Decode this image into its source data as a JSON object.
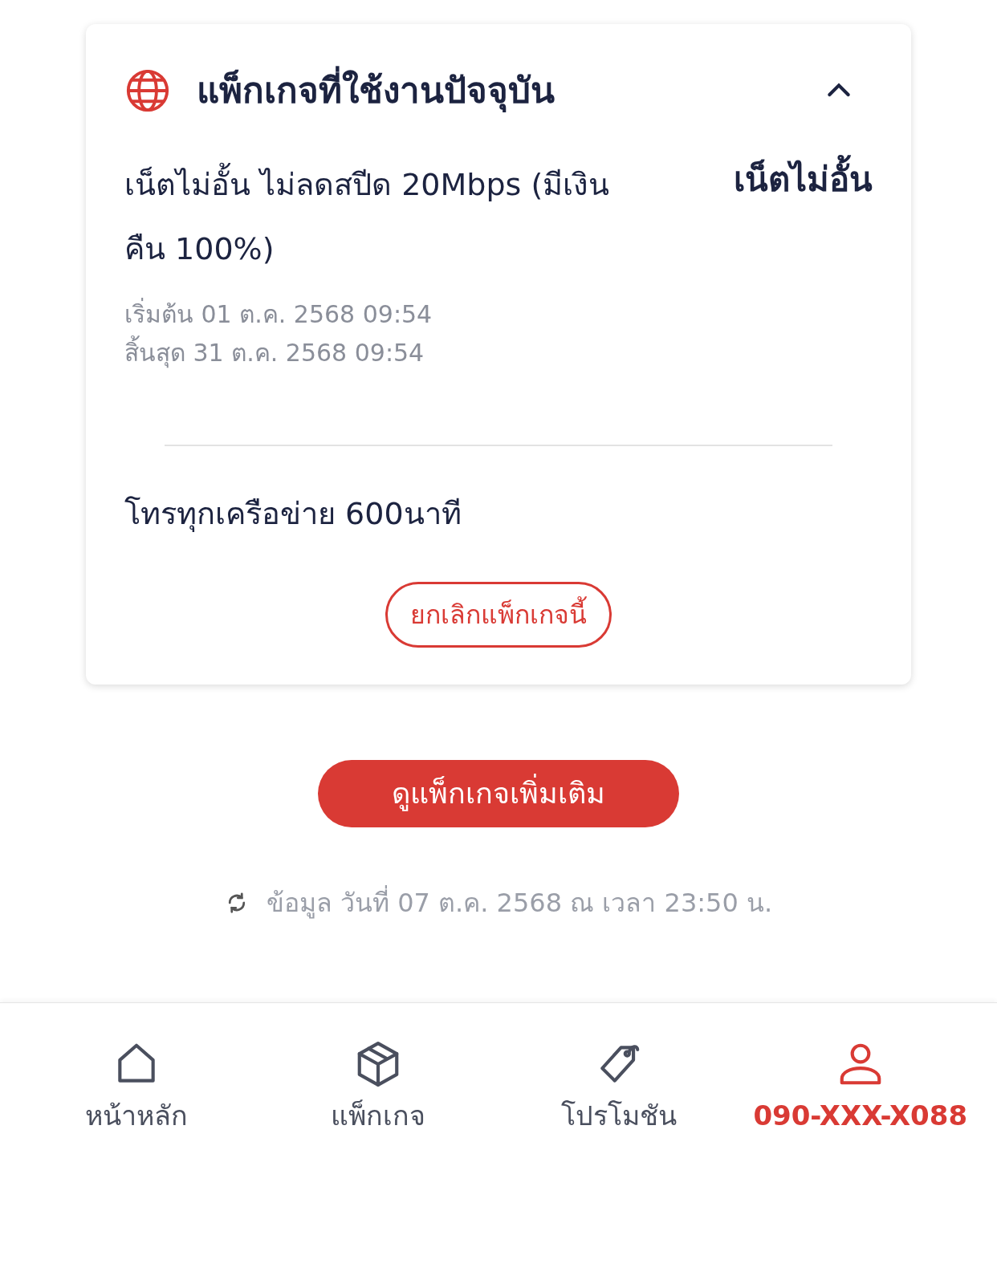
{
  "package_card": {
    "title": "แพ็กเกจที่ใช้งานปัจจุบัน",
    "expanded": true,
    "main_package": {
      "name": "เน็ตไม่อั้น ไม่ลดสปีด 20Mbps (มีเงินคืน 100%)",
      "tag": "เน็ตไม่อั้น",
      "start": "เริ่มต้น 01 ต.ค. 2568 09:54",
      "end": "สิ้นสุด 31 ต.ค. 2568 09:54"
    },
    "extra": "โทรทุกเครือข่าย 600นาที",
    "cancel_button": "ยกเลิกแพ็กเกจนี้"
  },
  "more_button": "ดูแพ็กเกจเพิ่มเติม",
  "updated": "ข้อมูล วันที่ 07 ต.ค. 2568 ณ เวลา 23:50 น.",
  "nav": [
    {
      "kind": "home",
      "label": "หน้าหลัก",
      "selected": false
    },
    {
      "kind": "box",
      "label": "แพ็กเกจ",
      "selected": false
    },
    {
      "kind": "tag",
      "label": "โปรโมชัน",
      "selected": false
    },
    {
      "kind": "user",
      "label": "090-XXX-X088",
      "selected": true
    }
  ]
}
